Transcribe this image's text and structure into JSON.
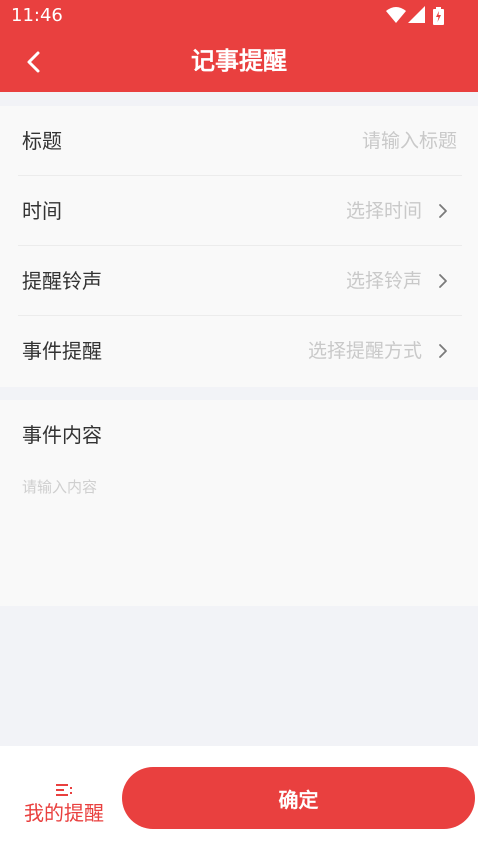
{
  "status_bar": {
    "time": "11:46"
  },
  "header": {
    "title": "记事提醒"
  },
  "form": {
    "title_row": {
      "label": "标题",
      "placeholder": "请输入标题"
    },
    "time_row": {
      "label": "时间",
      "value": "选择时间"
    },
    "ringtone_row": {
      "label": "提醒铃声",
      "value": "选择铃声"
    },
    "reminder_row": {
      "label": "事件提醒",
      "value": "选择提醒方式"
    }
  },
  "content": {
    "label": "事件内容",
    "placeholder": "请输入内容"
  },
  "bottom_bar": {
    "my_reminders_label": "我的提醒",
    "confirm_label": "确定"
  },
  "colors": {
    "accent": "#e9403f",
    "placeholder": "#c9c9c9",
    "background": "#f2f3f7"
  },
  "icons": [
    "wifi-icon",
    "signal-icon",
    "battery-icon",
    "back-arrow-icon",
    "chevron-right-icon",
    "list-icon"
  ]
}
